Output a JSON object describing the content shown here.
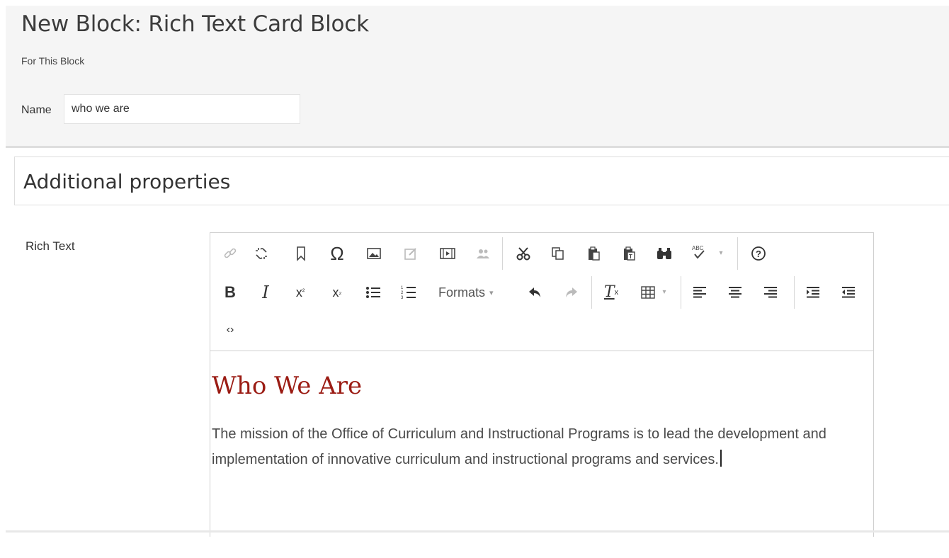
{
  "header": {
    "title": "New Block: Rich Text Card Block",
    "subtitle": "For This Block",
    "name_label": "Name",
    "name_value": "who we are"
  },
  "properties": {
    "title": "Additional properties",
    "rich_text_label": "Rich Text"
  },
  "toolbar": {
    "formats_label": "Formats",
    "row1": [
      "link-icon",
      "unlink-icon",
      "anchor-icon",
      "special-character-icon",
      "image-icon",
      "edit-image-icon",
      "media-icon",
      "personalized-content-icon",
      "cut-icon",
      "copy-icon",
      "paste-icon",
      "paste-text-icon",
      "find-replace-icon",
      "spellcheck-icon",
      "help-icon"
    ],
    "row2": [
      "bold-icon",
      "italic-icon",
      "superscript-icon",
      "subscript-icon",
      "bullet-list-icon",
      "numbered-list-icon",
      "formats-dropdown",
      "undo-icon",
      "redo-icon",
      "clear-formatting-icon",
      "table-icon",
      "align-left-icon",
      "align-center-icon",
      "align-right-icon",
      "indent-icon",
      "outdent-icon"
    ],
    "row3": [
      "source-code-icon"
    ]
  },
  "content": {
    "heading": "Who We Are",
    "paragraph": "The mission of the Office of Curriculum and Instructional Programs is to lead the development and implementation of innovative curriculum and instructional programs and services."
  },
  "colors": {
    "heading": "#9b1c14",
    "panel_bg": "#f5f5f5",
    "border": "#d0d0d0"
  }
}
